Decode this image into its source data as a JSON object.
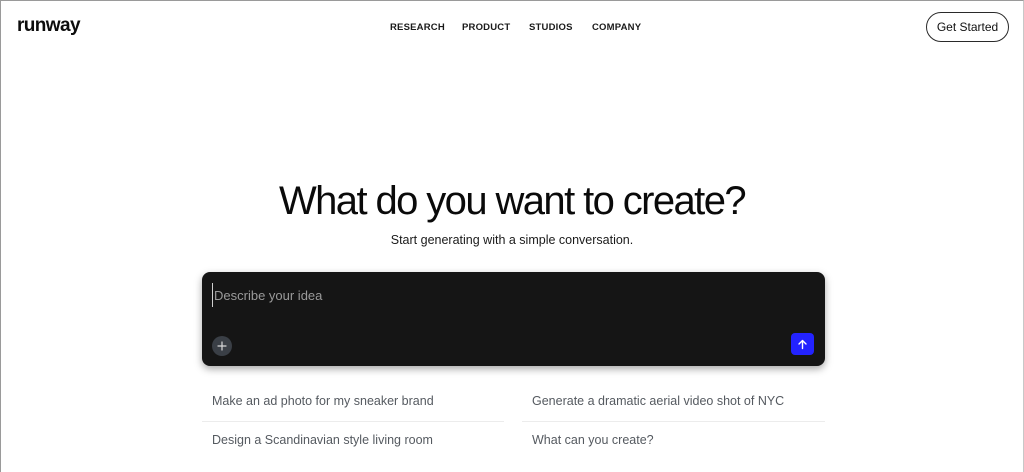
{
  "header": {
    "logo": "runway",
    "nav": [
      "RESEARCH",
      "PRODUCT",
      "STUDIOS",
      "COMPANY"
    ],
    "cta": "Get Started"
  },
  "hero": {
    "title": "What do you want to create?",
    "subtitle": "Start generating with a simple conversation."
  },
  "prompt": {
    "placeholder": "Describe your idea",
    "value": ""
  },
  "icons": {
    "add": "plus-icon",
    "send": "arrow-up-icon"
  },
  "colors": {
    "prompt_bg": "#151515",
    "send_button": "#2323ff",
    "suggestion_text": "#555a60"
  },
  "suggestions": [
    "Make an ad photo for my sneaker brand",
    "Generate a dramatic aerial video shot of NYC",
    "Design a Scandinavian style living room",
    "What can you create?"
  ]
}
